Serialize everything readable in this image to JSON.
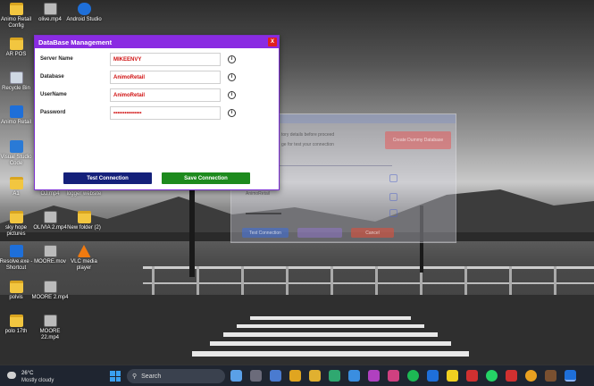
{
  "dialog": {
    "title": "DataBase Management",
    "close_label": "X",
    "fields": [
      {
        "label": "Server Name",
        "value": "MIKEENVY"
      },
      {
        "label": "Database",
        "value": "AnimoRetail"
      },
      {
        "label": "UserName",
        "value": "AnimoRetail"
      },
      {
        "label": "Password",
        "value": "•••••••••••••••"
      }
    ],
    "info_glyph": "i",
    "test_button": "Test Connection",
    "save_button": "Save Connection"
  },
  "ghost_window": {
    "line1": "tory details before proceed",
    "line2": "ge for test your connection",
    "create_button": "Create Dummy Database",
    "field_value": "AnimoRetail",
    "test_button": "Test Connection",
    "cancel_button": "Cancel"
  },
  "desktop_icons": [
    {
      "label": "Animo Retail Config",
      "icon": "folder-icon"
    },
    {
      "label": "olive.mp4",
      "icon": "video-icon"
    },
    {
      "label": "Android Studio",
      "icon": "android-studio-icon"
    },
    {
      "label": "AR POS",
      "icon": "folder-icon"
    },
    {
      "label": "Recycle Bin",
      "icon": "recycle-bin-icon"
    },
    {
      "label": "Animo Retail",
      "icon": "animo-retail-icon"
    },
    {
      "label": "Visual Studio Code",
      "icon": "vscode-icon"
    },
    {
      "label": "A1",
      "icon": "folder-icon"
    },
    {
      "label": "OJ.mp4",
      "icon": "video-icon"
    },
    {
      "label": "logger website",
      "icon": "folder-icon"
    },
    {
      "label": "sky hope pictures",
      "icon": "folder-icon"
    },
    {
      "label": "OLIVIA 2.mp4",
      "icon": "video-icon"
    },
    {
      "label": "New folder (2)",
      "icon": "folder-icon"
    },
    {
      "label": "Resolve.exe - Shortcut",
      "icon": "shortcut-icon"
    },
    {
      "label": "MOORE.mov",
      "icon": "video-icon"
    },
    {
      "label": "VLC media player",
      "icon": "vlc-icon"
    },
    {
      "label": "polvis",
      "icon": "folder-icon"
    },
    {
      "label": "MOORE 2.mp4",
      "icon": "video-icon"
    },
    {
      "label": "polo 17th",
      "icon": "folder-icon"
    },
    {
      "label": "MOORE 22.mp4",
      "icon": "video-icon"
    }
  ],
  "taskbar": {
    "temperature": "26°C",
    "weather": "Mostly cloudy",
    "search_placeholder": "Search",
    "icons": [
      "file-explorer-icon",
      "chat-icon",
      "task-view-icon",
      "folder-icon",
      "store-icon",
      "edge-icon",
      "mail-icon",
      "teams-icon",
      "app-icon",
      "instagram-icon",
      "spotify-icon",
      "outlook-icon",
      "sticky-notes-icon",
      "folder-icon",
      "whatsapp-icon",
      "media-icon",
      "chrome-icon",
      "app-icon",
      "animo-retail-icon"
    ]
  },
  "colors": {
    "title_bar": "#8a2be2",
    "close": "#e02020",
    "field_text": "#d01010",
    "test_button": "#14207a",
    "save_button": "#1d8a1d"
  }
}
